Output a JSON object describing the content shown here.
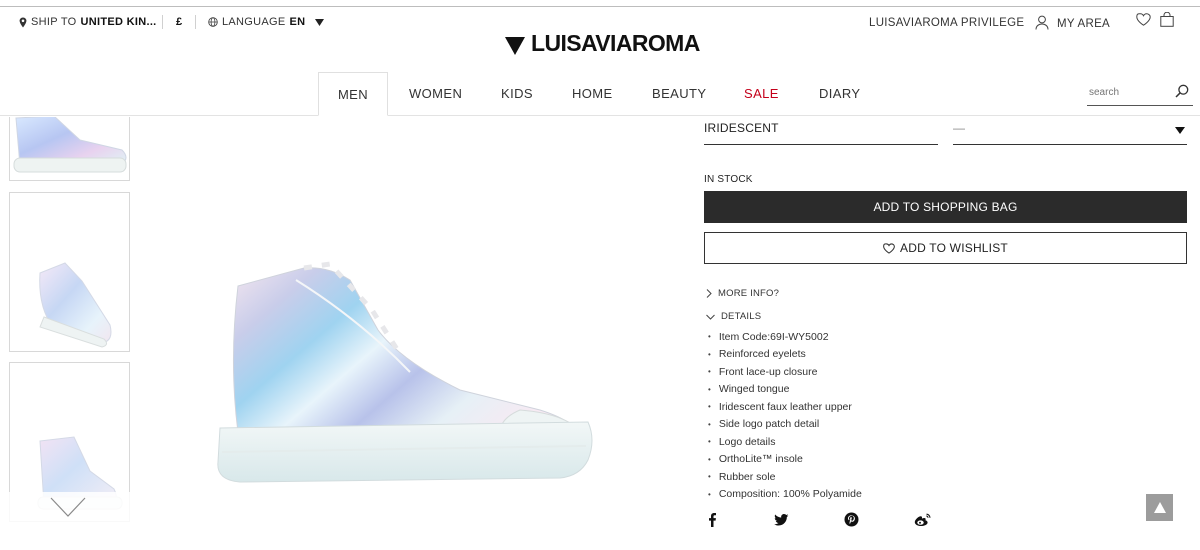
{
  "topbar": {
    "ship_prefix": "SHIP TO",
    "ship_country": "UNITED KIN...",
    "currency": "£",
    "language_label": "LANGUAGE",
    "language_value": "EN",
    "privilege": "LUISAVIAROMA PRIVILEGE",
    "my_area": "MY AREA"
  },
  "logo": {
    "text": "LUISAVIAROMA"
  },
  "nav": {
    "tabs": [
      "MEN",
      "WOMEN",
      "KIDS",
      "HOME",
      "BEAUTY",
      "SALE",
      "DIARY"
    ]
  },
  "search": {
    "placeholder": "search"
  },
  "product": {
    "color": "IRIDESCENT",
    "size_placeholder": "—",
    "stock": "IN STOCK",
    "add_to_bag": "ADD TO SHOPPING BAG",
    "add_to_wishlist": "ADD TO WISHLIST",
    "more_info": "MORE INFO?",
    "details_label": "DETAILS",
    "details": [
      "Item Code:69I-WY5002",
      "Reinforced eyelets",
      "Front lace-up closure",
      "Winged tongue",
      "Iridescent faux leather upper",
      "Side logo patch detail",
      "Logo details",
      "OrthoLite™ insole",
      "Rubber sole",
      "Composition: 100% Polyamide"
    ]
  },
  "social": [
    "facebook-icon",
    "twitter-icon",
    "pinterest-icon",
    "weibo-icon"
  ],
  "colors": {
    "sale": "#c4001a",
    "button_dark": "#2b2b2b"
  }
}
